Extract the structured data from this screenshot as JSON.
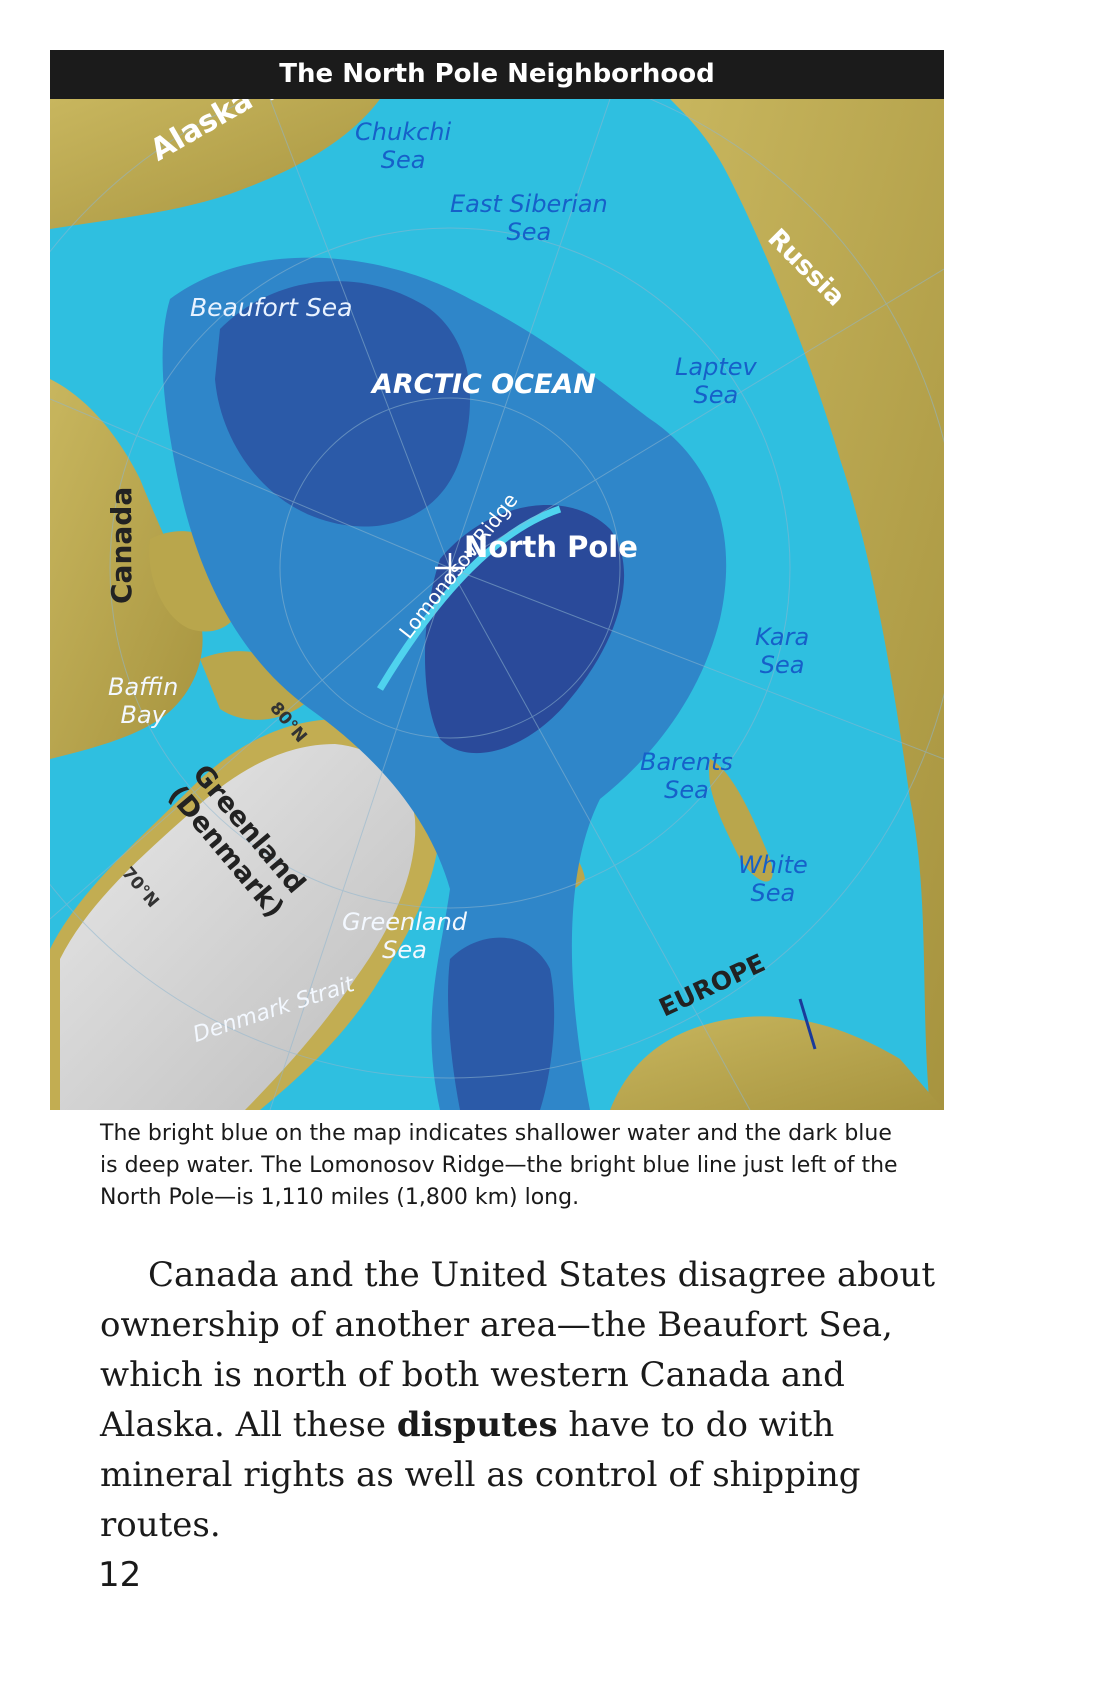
{
  "map": {
    "title": "The North Pole Neighborhood",
    "labels": {
      "alaska": "Alaska (USA)",
      "chukchi_sea_1": "Chukchi",
      "chukchi_sea_2": "Sea",
      "east_siberian_sea_1": "East Siberian",
      "east_siberian_sea_2": "Sea",
      "russia": "Russia",
      "beaufort_sea": "Beaufort Sea",
      "arctic_ocean": "ARCTIC OCEAN",
      "laptev_sea_1": "Laptev",
      "laptev_sea_2": "Sea",
      "lomonosov_ridge": "Lomonosov Ridge",
      "north_pole": "North Pole",
      "canada": "Canada",
      "kara_sea_1": "Kara",
      "kara_sea_2": "Sea",
      "baffin_bay_1": "Baffin",
      "baffin_bay_2": "Bay",
      "lat_80": "80°N",
      "lat_70": "70°N",
      "greenland_1": "Greenland",
      "greenland_2": "(Denmark)",
      "barents_sea_1": "Barents",
      "barents_sea_2": "Sea",
      "white_sea_1": "White",
      "white_sea_2": "Sea",
      "greenland_sea_1": "Greenland",
      "greenland_sea_2": "Sea",
      "denmark_strait": "Denmark Strait",
      "europe": "EUROPE"
    },
    "colors": {
      "deep_water": "#2b5aa8",
      "mid_water": "#2f86c9",
      "shallow_water": "#2fc3e0",
      "land": "#c9b65a",
      "ice": "#d9d9d9"
    }
  },
  "caption": "The bright blue on the map indicates shallower water and the dark blue is deep water. The Lomonosov Ridge—the bright blue line just left of the North Pole—is 1,110 miles (1,800 km) long.",
  "body": {
    "before": "Canada and the United States disagree about ownership of another area—the Beaufort Sea, which is north of both western Canada and Alaska. All these ",
    "bold": "disputes",
    "after": " have to do with mineral rights as well as control of shipping routes."
  },
  "page_number": "12"
}
